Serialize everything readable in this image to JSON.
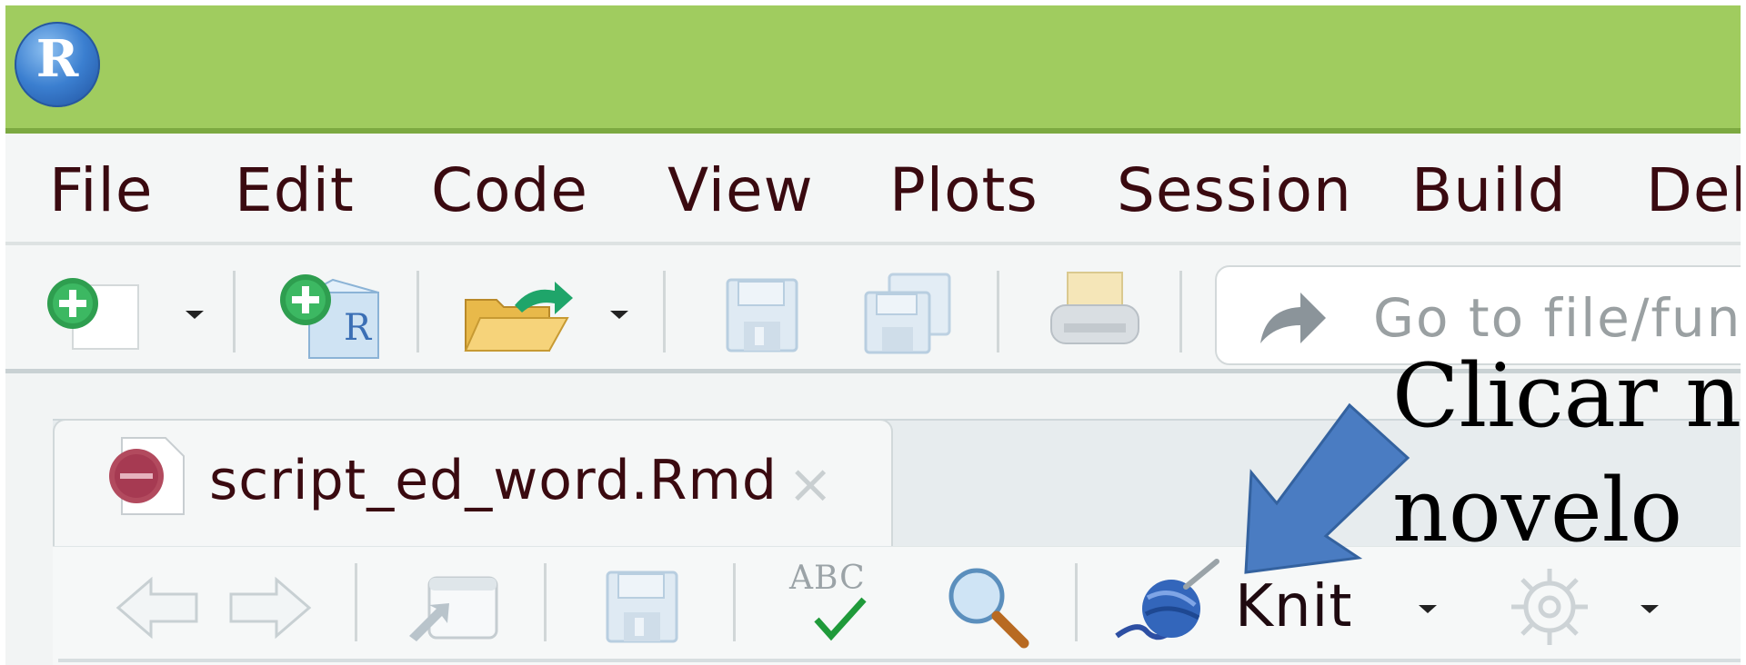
{
  "app": {
    "logo_letter": "R"
  },
  "menu": {
    "items": [
      "File",
      "Edit",
      "Code",
      "View",
      "Plots",
      "Session",
      "Build",
      "Deb"
    ]
  },
  "toolbar": {
    "goto_placeholder": "Go to file/fun"
  },
  "editor": {
    "tab": {
      "label": "script_ed_word.Rmd",
      "close": "×"
    },
    "toolbar": {
      "knit_label": "Knit",
      "spell_check_text": "ABC"
    }
  },
  "annotation": {
    "line1": "Clicar no",
    "line2": "novelo",
    "arrow_color": "#4a7cc2"
  },
  "colors": {
    "title_bar": "#a0cc5f",
    "menu_text": "#3a0a10"
  }
}
